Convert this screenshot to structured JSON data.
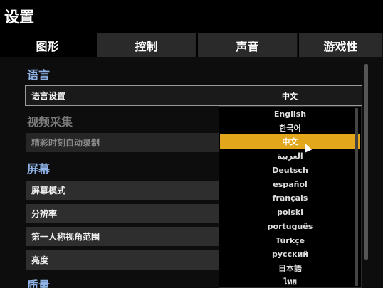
{
  "window": {
    "title": "设置"
  },
  "tabs": [
    {
      "label": "图形",
      "active": true
    },
    {
      "label": "控制",
      "active": false
    },
    {
      "label": "声音",
      "active": false
    },
    {
      "label": "游戏性",
      "active": false
    }
  ],
  "sections": {
    "language": {
      "title": "语言",
      "rows": [
        {
          "label": "语言设置",
          "value": "中文"
        }
      ]
    },
    "video_capture": {
      "title": "视频采集",
      "rows": [
        {
          "label": "精彩时刻自动录制"
        }
      ]
    },
    "screen": {
      "title": "屏幕",
      "rows": [
        {
          "label": "屏幕模式"
        },
        {
          "label": "分辨率"
        },
        {
          "label": "第一人称视角范围"
        },
        {
          "label": "亮度"
        }
      ]
    },
    "quality": {
      "title": "质量"
    }
  },
  "language_dropdown": {
    "selected": "中文",
    "options": [
      "English",
      "한국어",
      "中文",
      "العربية",
      "Deutsch",
      "español",
      "français",
      "polski",
      "português",
      "Türkçe",
      "русский",
      "日本語",
      "ไทย"
    ]
  },
  "colors": {
    "accent": "#e2a71a",
    "section_title": "#8fb3e6"
  }
}
